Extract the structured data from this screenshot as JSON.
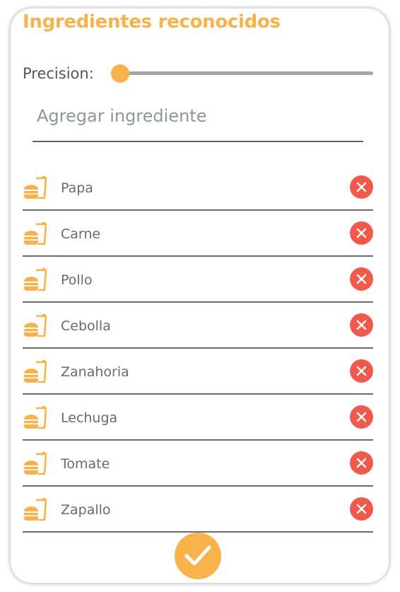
{
  "header": {
    "title": "Ingredientes reconocidos"
  },
  "precision": {
    "label": "Precision:",
    "value": 0
  },
  "add_input": {
    "placeholder": "Agregar ingrediente",
    "value": ""
  },
  "ingredients": [
    {
      "name": "Papa"
    },
    {
      "name": "Carne"
    },
    {
      "name": "Pollo"
    },
    {
      "name": "Cebolla"
    },
    {
      "name": "Zanahoria"
    },
    {
      "name": "Lechuga"
    },
    {
      "name": "Tomate"
    },
    {
      "name": "Zapallo"
    }
  ],
  "icons": {
    "ingredient": "fastfood-icon",
    "remove": "close-circle-icon",
    "confirm": "check-icon"
  },
  "colors": {
    "accent": "#f9b24a",
    "remove": "#f2594d",
    "divider": "#6c6c6c",
    "text": "#6a6a6a"
  }
}
